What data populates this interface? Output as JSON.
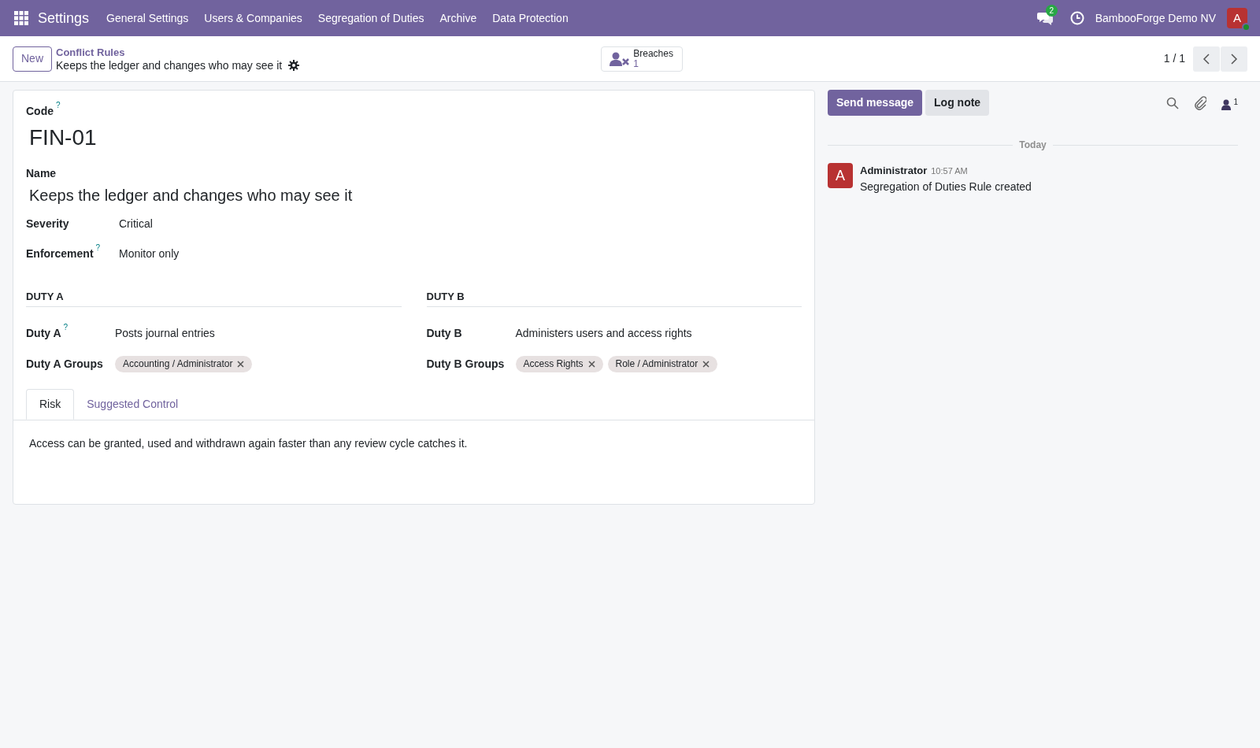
{
  "navbar": {
    "app": "Settings",
    "menus": [
      "General Settings",
      "Users & Companies",
      "Segregation of Duties",
      "Archive",
      "Data Protection"
    ],
    "messages_count": "2",
    "company": "BambooForge Demo NV",
    "avatar": "A"
  },
  "control_panel": {
    "new_button": "New",
    "breadcrumb": "Conflict Rules",
    "record": "Keeps the ledger and changes who may see it",
    "smart_button": {
      "label": "Breaches",
      "count": "1"
    },
    "pager": "1 / 1"
  },
  "form": {
    "code_label": "Code",
    "code_help": "?",
    "code": "FIN-01",
    "name_label": "Name",
    "name": "Keeps the ledger and changes who may see it",
    "fields": [
      {
        "label": "Severity",
        "value": "Critical"
      },
      {
        "label": "Enforcement",
        "help": "?",
        "value": "Monitor only"
      }
    ],
    "groups": [
      {
        "title": "DUTY A",
        "fields": [
          {
            "kind": "text",
            "label": "Duty A",
            "help": "?",
            "value": "Posts journal entries"
          },
          {
            "kind": "tags",
            "label": "Duty A Groups",
            "tags": [
              "Accounting / Administrator"
            ]
          }
        ]
      },
      {
        "title": "DUTY B",
        "fields": [
          {
            "kind": "text",
            "label": "Duty B",
            "value": "Administers users and access rights"
          },
          {
            "kind": "tags",
            "label": "Duty B Groups",
            "tags": [
              "Access Rights",
              "Role / Administrator"
            ]
          }
        ]
      }
    ],
    "tabs": [
      {
        "label": "Risk",
        "selected": true
      },
      {
        "label": "Suggested Control",
        "selected": false
      }
    ],
    "tab_content": "Access can be granted, used and withdrawn again faster than any review cycle catches it."
  },
  "chatter": {
    "buttons": [
      {
        "label": "Send message",
        "primary": true
      },
      {
        "label": "Log note",
        "primary": false
      }
    ],
    "followers_count": "1",
    "date_separator": "Today",
    "messages": [
      {
        "avatar": "A",
        "author": "Administrator",
        "time": "10:57 AM",
        "body": "Segregation of Duties Rule created"
      }
    ]
  }
}
